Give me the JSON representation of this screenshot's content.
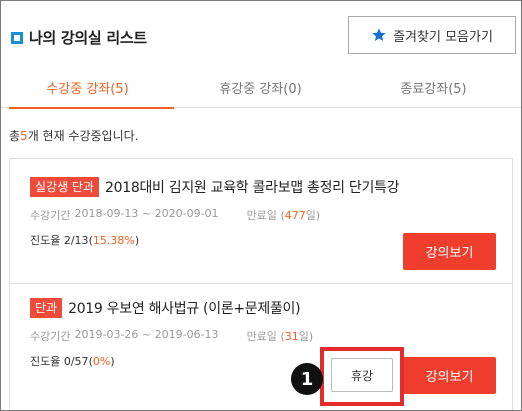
{
  "header": {
    "title": "나의 강의실 리스트",
    "favorites_button": "즐겨찾기 모음가기"
  },
  "tabs": [
    {
      "label": "수강중 강좌(5)",
      "active": true
    },
    {
      "label": "휴강중 강좌(0)",
      "active": false
    },
    {
      "label": "종료강좌(5)",
      "active": false
    }
  ],
  "summary": {
    "prefix": "총",
    "count": "5",
    "suffix": "개 현재 수강중입니다."
  },
  "courses": [
    {
      "badge": "실강생 단과",
      "title": "2018대비 김지원 교육학 콜라보맵 총정리 단기특강",
      "period_label": "수강기간",
      "period": "2018-09-13 ~ 2020-09-01",
      "end_label": "만료일",
      "days_open": "(",
      "days": "477",
      "days_close": "일)",
      "progress_label": "진도율 2/13",
      "progress_open": "(",
      "progress_pct": "15.38%",
      "progress_close": ")",
      "watch_button": "강의보기"
    },
    {
      "badge": "단과",
      "title": "2019 우보연 해사법규 (이론+문제풀이)",
      "period_label": "수강기간",
      "period": "2019-03-26 ~ 2019-06-13",
      "end_label": "만료일",
      "days_open": "(",
      "days": "31",
      "days_close": "일)",
      "progress_label": "진도율 0/57",
      "progress_open": "(",
      "progress_pct": "0%",
      "progress_close": ")",
      "pause_button": "휴강",
      "watch_button": "강의보기"
    }
  ],
  "annotation": {
    "step_number": "1"
  },
  "colors": {
    "accent": "#f06022",
    "button_red": "#f03e2e",
    "badge_red": "#f04a3a",
    "title_square": "#1a8fd6",
    "highlight": "#e62b2b"
  },
  "icons": {
    "favorites": "star-icon"
  }
}
